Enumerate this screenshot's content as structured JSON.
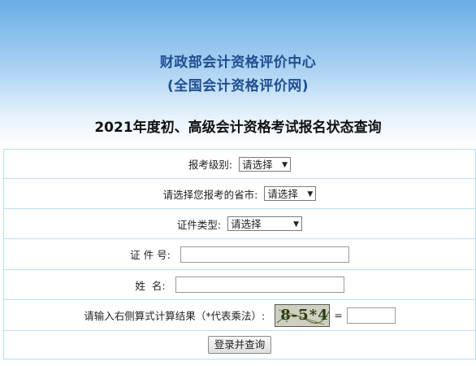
{
  "header": {
    "org_name": "财政部会计资格评价中心",
    "org_site": "(全国会计资格评价网)",
    "page_title": "2021年度初、高级会计资格考试报名状态查询"
  },
  "form": {
    "level_label": "报考级别:",
    "level_value": "请选择",
    "province_label": "请选择您报考的省市:",
    "province_value": "请选择",
    "id_type_label": "证件类型:",
    "id_type_value": "请选择",
    "id_number_label": "证 件 号:",
    "id_number_value": "",
    "name_label": "姓  名:",
    "name_value": "",
    "captcha_label": "请输入右侧算式计算结果（*代表乘法）:",
    "captcha_text": "8-5*4",
    "equals": "=",
    "captcha_answer": "",
    "submit_label": "登录并查询"
  },
  "icons": {
    "dropdown": "chevron-down-icon"
  }
}
